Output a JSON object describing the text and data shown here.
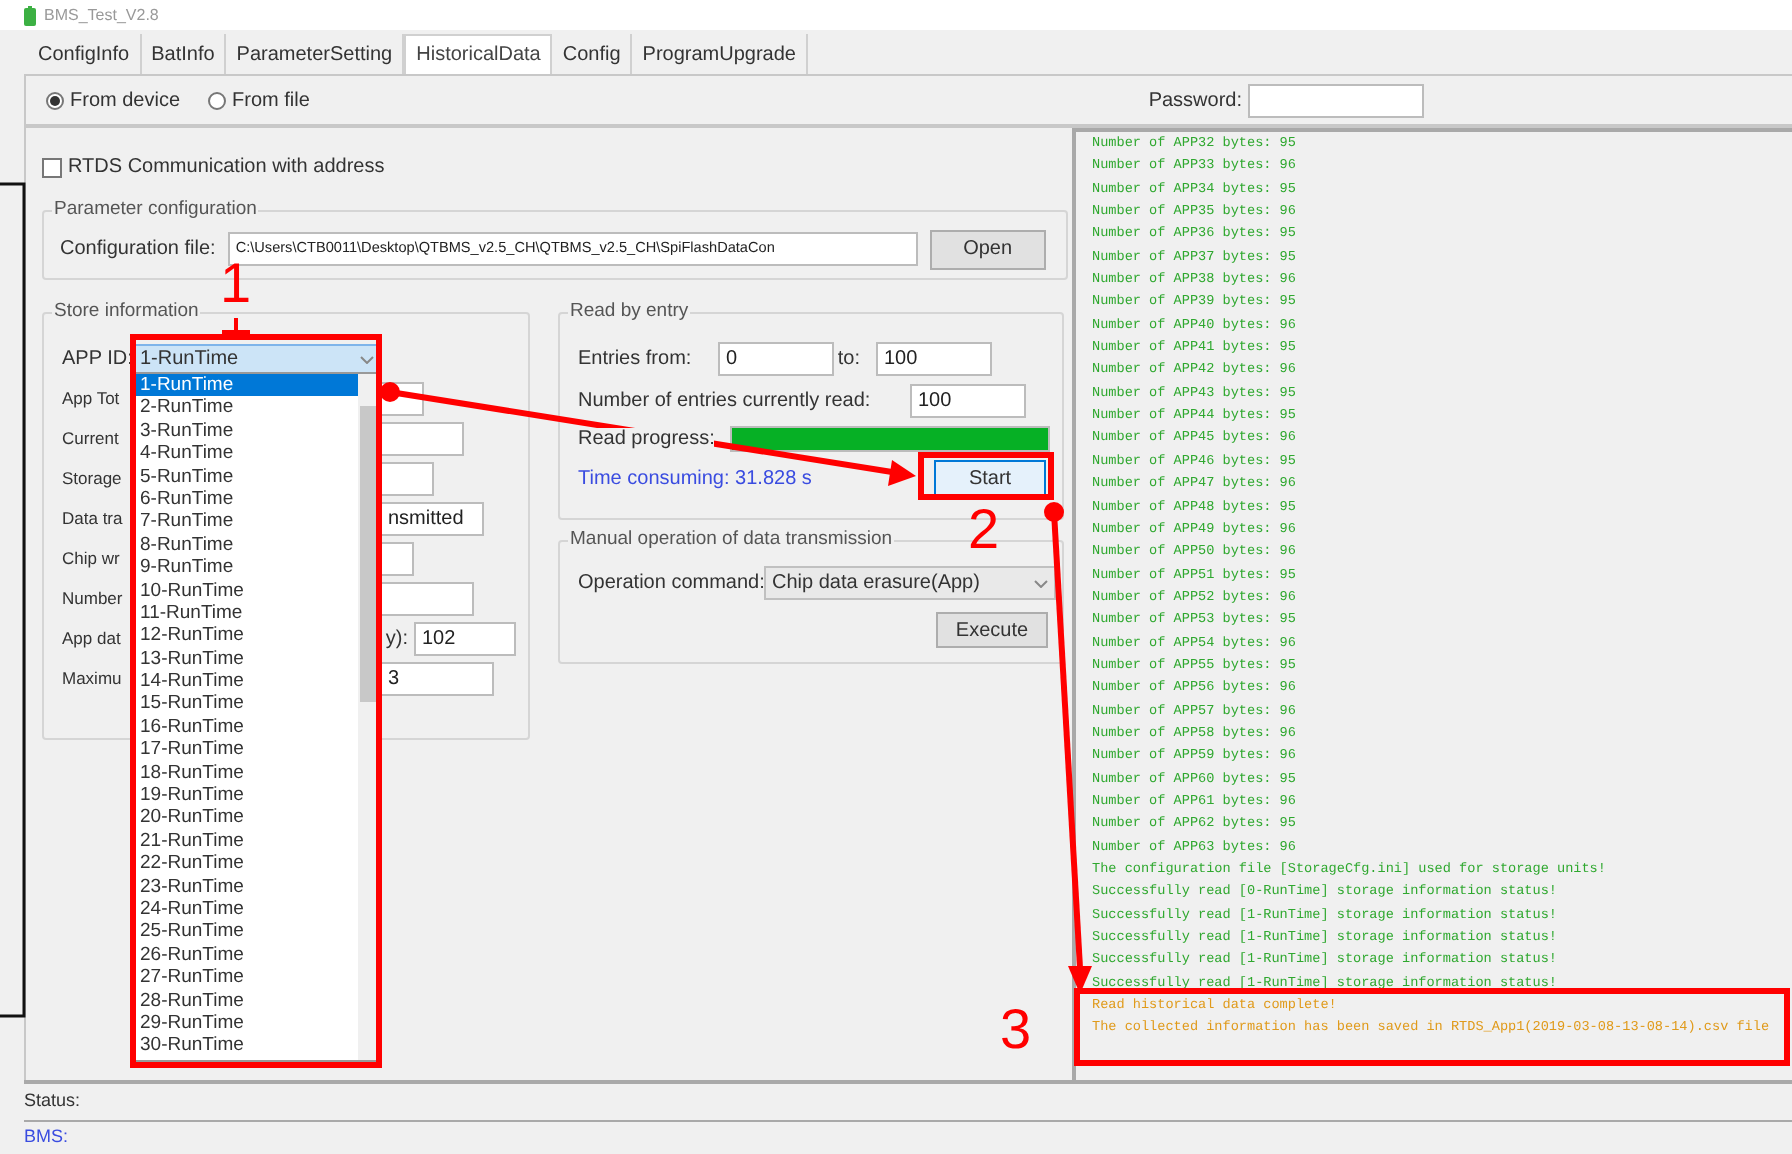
{
  "window": {
    "title": "BMS_Test_V2.8"
  },
  "tabs": [
    {
      "label": "ConfigInfo",
      "selected": false
    },
    {
      "label": "BatInfo",
      "selected": false
    },
    {
      "label": "ParameterSetting",
      "selected": false
    },
    {
      "label": "HistoricalData",
      "selected": true
    },
    {
      "label": "Config",
      "selected": false
    },
    {
      "label": "ProgramUpgrade",
      "selected": false
    }
  ],
  "source_options": [
    {
      "label": "From device",
      "selected": true
    },
    {
      "label": "From file",
      "selected": false
    }
  ],
  "password": {
    "label": "Password:"
  },
  "rtds_checkbox": {
    "label": "RTDS Communication with address",
    "checked": false
  },
  "parameter_configuration": {
    "title": "Parameter configuration",
    "file_label": "Configuration file:",
    "file_value": "C:\\Users\\CTB0011\\Desktop\\QTBMS_v2.5_CH\\QTBMS_v2.5_CH\\SpiFlashDataCon",
    "button": "Open"
  },
  "store_information": {
    "title": "Store information",
    "app_id": {
      "label": "APP ID:",
      "value": "1-RunTime"
    },
    "rows": [
      {
        "label": "App Tot"
      },
      {
        "label": "Current"
      },
      {
        "label": "Storage"
      },
      {
        "label": "Data tra",
        "value": "nsmitted"
      },
      {
        "label": "Chip wr"
      },
      {
        "label": "Number"
      },
      {
        "label": "App dat",
        "tail": "y):",
        "value": "102"
      },
      {
        "label": "Maximu",
        "value": "3"
      }
    ]
  },
  "dropdown": {
    "items": [
      {
        "label": "1-RunTime",
        "selected": true
      },
      {
        "label": "2-RunTime",
        "selected": false
      },
      {
        "label": "3-RunTime",
        "selected": false
      },
      {
        "label": "4-RunTime",
        "selected": false
      },
      {
        "label": "5-RunTime",
        "selected": false
      },
      {
        "label": "6-RunTime",
        "selected": false
      },
      {
        "label": "7-RunTime",
        "selected": false
      },
      {
        "label": "8-RunTime",
        "selected": false
      },
      {
        "label": "9-RunTime",
        "selected": false
      },
      {
        "label": "10-RunTime",
        "selected": false
      },
      {
        "label": "11-RunTime",
        "selected": false
      },
      {
        "label": "12-RunTime",
        "selected": false
      },
      {
        "label": "13-RunTime",
        "selected": false
      },
      {
        "label": "14-RunTime",
        "selected": false
      },
      {
        "label": "15-RunTime",
        "selected": false
      },
      {
        "label": "16-RunTime",
        "selected": false
      },
      {
        "label": "17-RunTime",
        "selected": false
      },
      {
        "label": "18-RunTime",
        "selected": false
      },
      {
        "label": "19-RunTime",
        "selected": false
      },
      {
        "label": "20-RunTime",
        "selected": false
      },
      {
        "label": "21-RunTime",
        "selected": false
      },
      {
        "label": "22-RunTime",
        "selected": false
      },
      {
        "label": "23-RunTime",
        "selected": false
      },
      {
        "label": "24-RunTime",
        "selected": false
      },
      {
        "label": "25-RunTime",
        "selected": false
      },
      {
        "label": "26-RunTime",
        "selected": false
      },
      {
        "label": "27-RunTime",
        "selected": false
      },
      {
        "label": "28-RunTime",
        "selected": false
      },
      {
        "label": "29-RunTime",
        "selected": false
      },
      {
        "label": "30-RunTime",
        "selected": false
      }
    ]
  },
  "read_by_entry": {
    "title": "Read by entry",
    "from_label": "Entries from:",
    "from_value": "0",
    "to_label": "to:",
    "to_value": "100",
    "count_label": "Number of entries currently read:",
    "count_value": "100",
    "progress_label": "Read progress:",
    "progress": {
      "level": 1
    },
    "time_text": "Time consuming: 31.828 s",
    "start_button": "Start"
  },
  "manual_operation": {
    "title": "Manual operation of data transmission",
    "command_label": "Operation command:",
    "command_value": "Chip data erasure(App)",
    "execute_button": "Execute"
  },
  "log": {
    "lines": [
      {
        "text": "Number of APP32 bytes: 95",
        "kind": "info"
      },
      {
        "text": "Number of APP33 bytes: 96",
        "kind": "info"
      },
      {
        "text": "Number of APP34 bytes: 95",
        "kind": "info"
      },
      {
        "text": "Number of APP35 bytes: 96",
        "kind": "info"
      },
      {
        "text": "Number of APP36 bytes: 95",
        "kind": "info"
      },
      {
        "text": "Number of APP37 bytes: 95",
        "kind": "info"
      },
      {
        "text": "Number of APP38 bytes: 96",
        "kind": "info"
      },
      {
        "text": "Number of APP39 bytes: 95",
        "kind": "info"
      },
      {
        "text": "Number of APP40 bytes: 96",
        "kind": "info"
      },
      {
        "text": "Number of APP41 bytes: 95",
        "kind": "info"
      },
      {
        "text": "Number of APP42 bytes: 96",
        "kind": "info"
      },
      {
        "text": "Number of APP43 bytes: 95",
        "kind": "info"
      },
      {
        "text": "Number of APP44 bytes: 95",
        "kind": "info"
      },
      {
        "text": "Number of APP45 bytes: 96",
        "kind": "info"
      },
      {
        "text": "Number of APP46 bytes: 95",
        "kind": "info"
      },
      {
        "text": "Number of APP47 bytes: 96",
        "kind": "info"
      },
      {
        "text": "Number of APP48 bytes: 95",
        "kind": "info"
      },
      {
        "text": "Number of APP49 bytes: 96",
        "kind": "info"
      },
      {
        "text": "Number of APP50 bytes: 96",
        "kind": "info"
      },
      {
        "text": "Number of APP51 bytes: 95",
        "kind": "info"
      },
      {
        "text": "Number of APP52 bytes: 96",
        "kind": "info"
      },
      {
        "text": "Number of APP53 bytes: 95",
        "kind": "info"
      },
      {
        "text": "Number of APP54 bytes: 96",
        "kind": "info"
      },
      {
        "text": "Number of APP55 bytes: 95",
        "kind": "info"
      },
      {
        "text": "Number of APP56 bytes: 96",
        "kind": "info"
      },
      {
        "text": "Number of APP57 bytes: 96",
        "kind": "info"
      },
      {
        "text": "Number of APP58 bytes: 96",
        "kind": "info"
      },
      {
        "text": "Number of APP59 bytes: 96",
        "kind": "info"
      },
      {
        "text": "Number of APP60 bytes: 95",
        "kind": "info"
      },
      {
        "text": "Number of APP61 bytes: 96",
        "kind": "info"
      },
      {
        "text": "Number of APP62 bytes: 95",
        "kind": "info"
      },
      {
        "text": "Number of APP63 bytes: 96",
        "kind": "info"
      },
      {
        "text": "The configuration file [StorageCfg.ini] used for storage units!",
        "kind": "info"
      },
      {
        "text": "Successfully read [0-RunTime] storage information status!",
        "kind": "info"
      },
      {
        "text": "Successfully read [1-RunTime] storage information status!",
        "kind": "info"
      },
      {
        "text": "Successfully read [1-RunTime] storage information status!",
        "kind": "info"
      },
      {
        "text": "Successfully read [1-RunTime] storage information status!",
        "kind": "info"
      },
      {
        "text": "Successfully read [1-RunTime] storage information status!",
        "kind": "info"
      },
      {
        "text": "Read historical data complete!",
        "kind": "done"
      },
      {
        "text": "The collected information has been saved in RTDS_App1(2019-03-08-13-08-14).csv file",
        "kind": "done"
      }
    ]
  },
  "status_bar": {
    "status": "Status:",
    "bms": "BMS:"
  },
  "annotations": [
    {
      "label": "1"
    },
    {
      "label": "2"
    },
    {
      "label": "3"
    }
  ]
}
